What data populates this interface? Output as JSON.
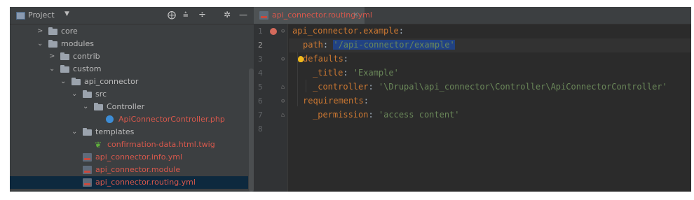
{
  "project_panel": {
    "title": "Project",
    "toolbar_icons": [
      "target-icon",
      "collapse-all-icon",
      "expand-icon",
      "gear-icon",
      "minimize-icon"
    ],
    "tree": [
      {
        "label": "core",
        "type": "folder",
        "expanded": false
      },
      {
        "label": "modules",
        "type": "folder",
        "expanded": true
      },
      {
        "label": "contrib",
        "type": "folder",
        "expanded": false
      },
      {
        "label": "custom",
        "type": "folder",
        "expanded": true
      },
      {
        "label": "api_connector",
        "type": "folder",
        "expanded": true
      },
      {
        "label": "src",
        "type": "folder",
        "expanded": true
      },
      {
        "label": "Controller",
        "type": "folder",
        "expanded": true
      },
      {
        "label": "ApiConnectorController.php",
        "type": "php-file"
      },
      {
        "label": "templates",
        "type": "folder",
        "expanded": true
      },
      {
        "label": "confirmation-data.html.twig",
        "type": "twig-file"
      },
      {
        "label": "api_connector.info.yml",
        "type": "yml-file"
      },
      {
        "label": "api_connector.module",
        "type": "module-file"
      },
      {
        "label": "api_connector.routing.yml",
        "type": "yml-file",
        "selected": true
      }
    ]
  },
  "editor": {
    "tab_label": "api_connector.routing.yml",
    "line_numbers": [
      "1",
      "2",
      "3",
      "4",
      "5",
      "6",
      "7",
      "8"
    ],
    "lines": [
      {
        "key": "api_connector.example",
        "colon": ":"
      },
      {
        "key": "path",
        "colon": ": ",
        "value": "'/api-connector/example'"
      },
      {
        "key": "defaults",
        "colon": ":"
      },
      {
        "key": "_title",
        "colon": ": ",
        "value": "'Example'"
      },
      {
        "key": "_controller",
        "colon": ": ",
        "value": "'\\Drupal\\api_connector\\Controller\\ApiConnectorController'"
      },
      {
        "key": "requirements",
        "colon": ":"
      },
      {
        "key": "_permission",
        "colon": ": ",
        "value": "'access content'"
      }
    ]
  },
  "colors": {
    "keyword": "#cc7832",
    "string": "#6a8759",
    "text": "#a9b7c6",
    "modified_file": "#d8584c",
    "selection": "#214283"
  }
}
